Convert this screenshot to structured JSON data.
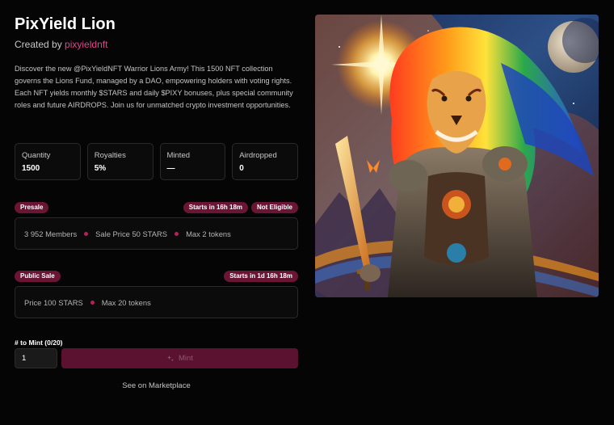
{
  "collection": {
    "title": "PixYield Lion",
    "created_by_prefix": "Created by",
    "creator": "pixyieldnft",
    "description": "Discover the new @PixYieldNFT Warrior Lions Army! This 1500 NFT collection governs the Lions Fund, managed by a DAO, empowering holders with voting rights. Each NFT yields monthly $STARS and daily $PIXY bonuses, plus special community roles and future AIRDROPS. Join us for unmatched crypto investment opportunities."
  },
  "stats": [
    {
      "label": "Quantity",
      "value": "1500"
    },
    {
      "label": "Royalties",
      "value": "5%"
    },
    {
      "label": "Minted",
      "value": "—"
    },
    {
      "label": "Airdropped",
      "value": "0"
    }
  ],
  "presale": {
    "label": "Presale",
    "starts": "Starts in 16h 18m",
    "eligibility": "Not Eligible",
    "members": "3 952 Members",
    "price": "Sale Price 50 STARS",
    "max": "Max 2 tokens"
  },
  "public_sale": {
    "label": "Public Sale",
    "starts": "Starts in 1d 16h 18m",
    "price": "Price 100 STARS",
    "max": "Max 20 tokens"
  },
  "mint": {
    "label": "# to Mint (0/20)",
    "quantity": "1",
    "button_label": "Mint",
    "marketplace_link": "See on Marketplace"
  },
  "colors": {
    "accent": "#6b1535",
    "creator_link": "#e0468a",
    "background": "#050505"
  },
  "icons": {
    "mint_button": "sparkle-icon"
  }
}
